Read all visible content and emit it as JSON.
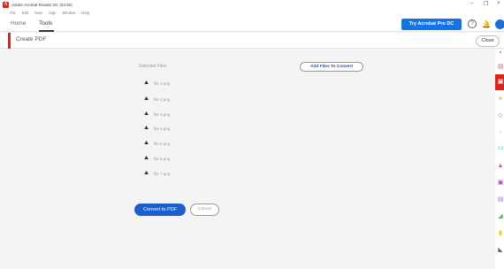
{
  "window": {
    "title": "Adobe Acrobat Reader DC (64-bit)",
    "controls": [
      "–",
      "❐",
      "×"
    ]
  },
  "menubar": [
    "File",
    "Edit",
    "View",
    "Sign",
    "Window",
    "Help"
  ],
  "nav": {
    "tabs": [
      "Home",
      "Tools"
    ],
    "try_button": "Try Acrobat Pro DC",
    "help": "?"
  },
  "toolbar": {
    "title": "Create PDF",
    "close_label": "Close"
  },
  "main": {
    "selected_label": "Selected Files",
    "add_button": "Add Files To Convert",
    "files": [
      "file 1.png",
      "file 2.png",
      "file 3.png",
      "file 4.png",
      "file 5.png",
      "file 6.png",
      "file 7.png"
    ],
    "convert_button": "Convert to PDF",
    "cancel_button": "Cancel"
  },
  "colors": {
    "accent": "#1473e6",
    "brand_red": "#d7261e",
    "convert_blue": "#1c5ecc"
  },
  "right_tools": [
    "green-tool-icon",
    "pink-tool-icon",
    "create-pdf-tool-icon",
    "yellow-tool-icon",
    "purple-tool-icon",
    "green-tool-icon-2",
    "teal-tool-icon",
    "pink-tool-icon-2",
    "magenta-tool-icon",
    "purple-tool-icon-2",
    "green-tool-icon-3",
    "yellow-tool-icon-2",
    "gray-tool-icon"
  ]
}
